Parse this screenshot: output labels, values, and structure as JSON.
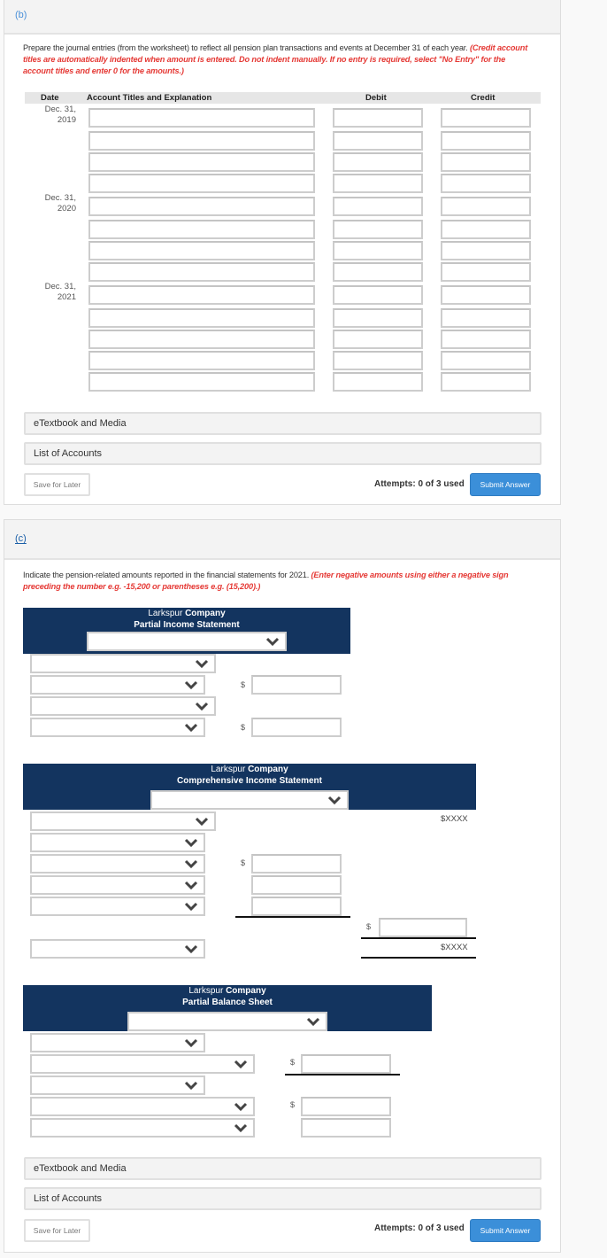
{
  "part_b": {
    "label": "(b)",
    "instruction_plain": "Prepare the journal entries (from the worksheet) to reflect all pension plan transactions and events at December 31 of each year. ",
    "instruction_emphasis": "(Credit account titles are automatically indented when amount is entered. Do not indent manually. If no entry is required, select \"No Entry\" for the account titles and enter 0 for the amounts.)",
    "journal": {
      "headers": {
        "date": "Date",
        "account": "Account Titles and Explanation",
        "debit": "Debit",
        "credit": "Credit"
      },
      "rows": [
        {
          "date_line1": "Dec. 31,",
          "date_line2": "2019",
          "account": "",
          "debit": "",
          "credit": ""
        },
        {
          "date_line1": "",
          "date_line2": "",
          "account": "",
          "debit": "",
          "credit": ""
        },
        {
          "date_line1": "",
          "date_line2": "",
          "account": "",
          "debit": "",
          "credit": ""
        },
        {
          "date_line1": "",
          "date_line2": "",
          "account": "",
          "debit": "",
          "credit": ""
        },
        {
          "date_line1": "Dec. 31,",
          "date_line2": "2020",
          "account": "",
          "debit": "",
          "credit": ""
        },
        {
          "date_line1": "",
          "date_line2": "",
          "account": "",
          "debit": "",
          "credit": ""
        },
        {
          "date_line1": "",
          "date_line2": "",
          "account": "",
          "debit": "",
          "credit": ""
        },
        {
          "date_line1": "",
          "date_line2": "",
          "account": "",
          "debit": "",
          "credit": ""
        },
        {
          "date_line1": "Dec. 31,",
          "date_line2": "2021",
          "account": "",
          "debit": "",
          "credit": ""
        },
        {
          "date_line1": "",
          "date_line2": "",
          "account": "",
          "debit": "",
          "credit": ""
        },
        {
          "date_line1": "",
          "date_line2": "",
          "account": "",
          "debit": "",
          "credit": ""
        },
        {
          "date_line1": "",
          "date_line2": "",
          "account": "",
          "debit": "",
          "credit": ""
        },
        {
          "date_line1": "",
          "date_line2": "",
          "account": "",
          "debit": "",
          "credit": ""
        }
      ]
    },
    "etextbook_label": "eTextbook and Media",
    "list_accounts_label": "List of Accounts",
    "save_label": "Save for Later",
    "attempts_text": "Attempts: 0 of 3 used",
    "submit_label": "Submit Answer"
  },
  "part_c": {
    "label": "(c)",
    "instruction_plain": "Indicate the pension-related amounts reported in the financial statements for 2021. ",
    "instruction_emphasis": "(Enter negative amounts using either a negative sign preceding the number e.g. -15,200 or parentheses e.g. (15,200).)",
    "income_statement": {
      "company_plain": "Larkspur ",
      "company_bold": "Company",
      "title": "Partial Income Statement",
      "period_select": "",
      "currency_symbol": "$"
    },
    "comprehensive_statement": {
      "company_plain": "Larkspur ",
      "company_bold": "Company",
      "title": "Comprehensive Income Statement",
      "period_select": "",
      "currency_symbol": "$",
      "placeholder_top": "$XXXX",
      "placeholder_bottom": "$XXXX"
    },
    "balance_sheet": {
      "company_plain": "Larkspur ",
      "company_bold": "Company",
      "title": "Partial Balance Sheet",
      "period_select": "",
      "currency_symbol": "$"
    },
    "etextbook_label": "eTextbook and Media",
    "list_accounts_label": "List of Accounts",
    "save_label": "Save for Later",
    "attempts_text": "Attempts: 0 of 3 used",
    "submit_label": "Submit Answer"
  },
  "colors": {
    "header_navy": "#13345f",
    "submit_blue": "#3b8fd9",
    "emphasis_red": "#e53935",
    "part_label_blue": "#4a90d9"
  }
}
